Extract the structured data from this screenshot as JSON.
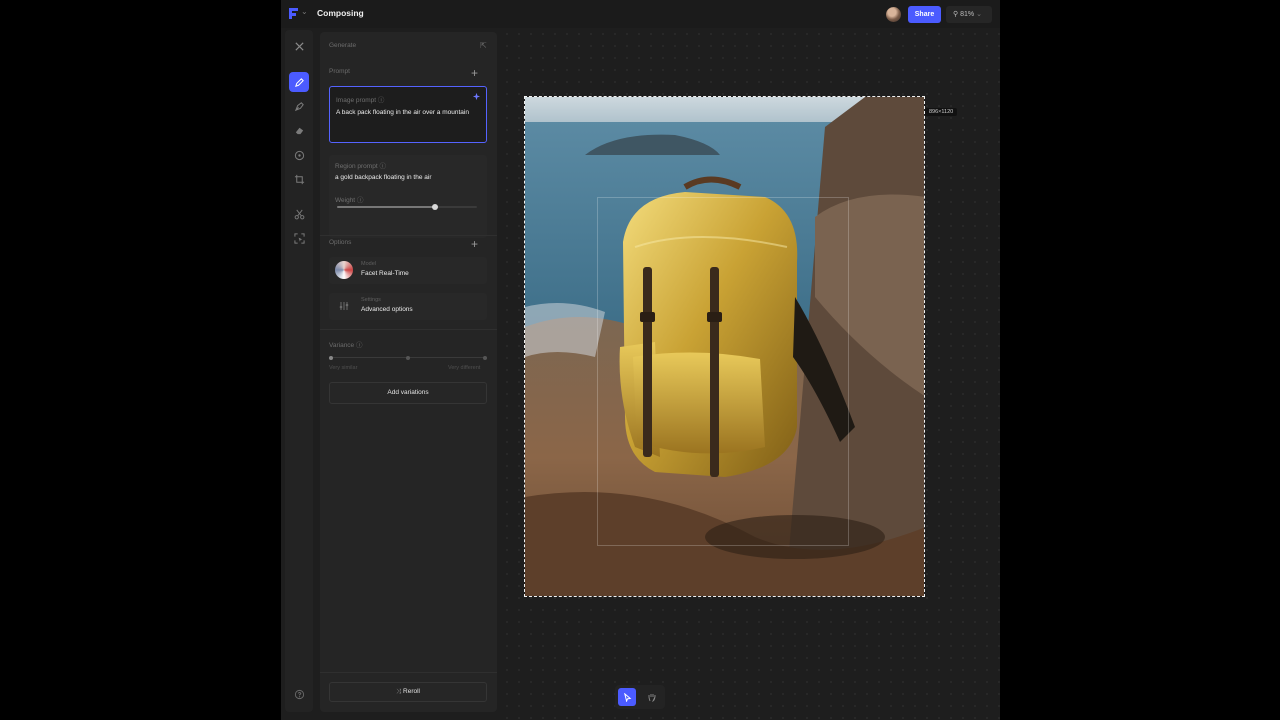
{
  "topbar": {
    "title": "Composing",
    "share_label": "Share",
    "zoom_level": "81%"
  },
  "panel": {
    "section_title": "Generate",
    "prompt_header": "Prompt",
    "image_prompt_label": "Image prompt",
    "image_prompt_value": "A back pack floating in the air over a mountain",
    "region_prompt_label": "Region prompt",
    "region_prompt_value": "a gold backpack floating in the air",
    "weight_label": "Weight",
    "weight_value": 0.7,
    "options_header": "Options",
    "model_small": "Model",
    "model_value": "Facet Real-Time",
    "settings_small": "Settings",
    "settings_value": "Advanced options",
    "variance_label": "Variance",
    "variance_min_label": "Very similar",
    "variance_max_label": "Very different",
    "add_variations_label": "Add variations",
    "reroll_label": "Reroll"
  },
  "canvas": {
    "size_label": "896×1120"
  },
  "colors": {
    "accent": "#4b5bff",
    "background": "#1e1e1e",
    "panel": "#252525"
  },
  "icons": {
    "rail": [
      "close-icon",
      "pencil-icon",
      "pen-icon",
      "eraser-icon",
      "move-icon",
      "crop-icon",
      "scissors-icon",
      "select-icon",
      "help-icon"
    ],
    "bottom": [
      "pointer-icon",
      "hand-icon"
    ]
  }
}
